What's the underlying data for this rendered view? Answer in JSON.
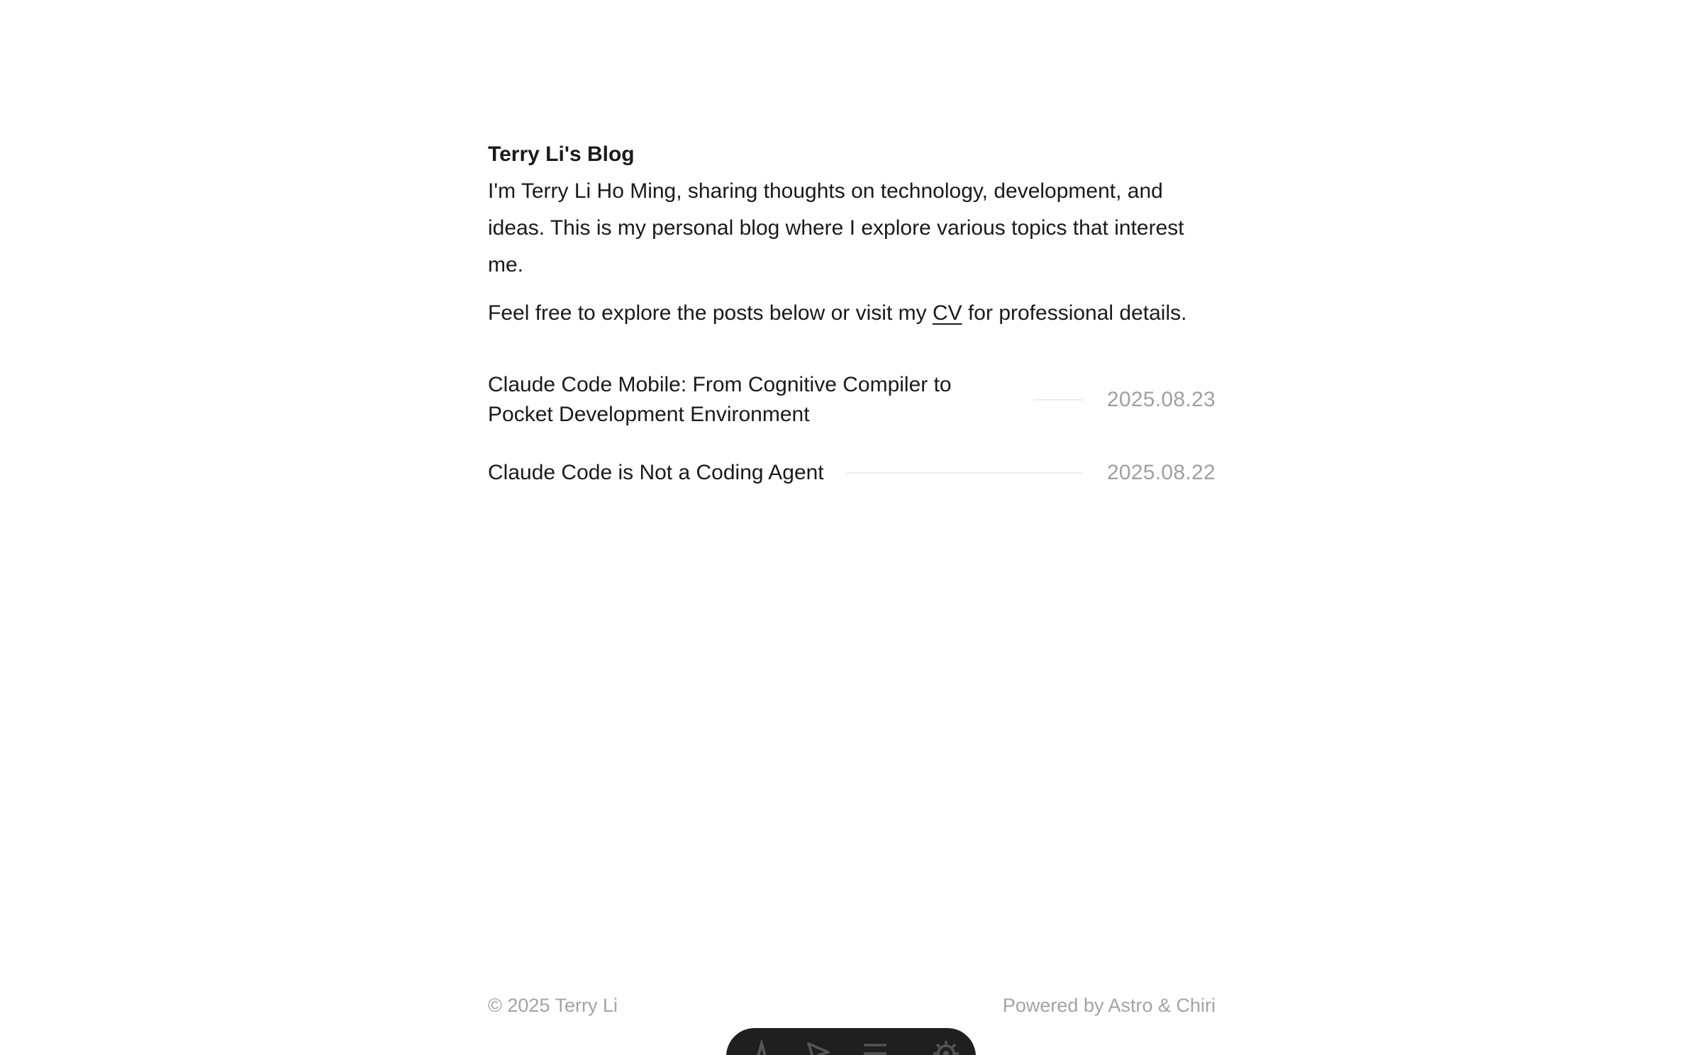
{
  "header": {
    "site_title": "Terry Li's Blog"
  },
  "intro": {
    "paragraph1": "I'm Terry Li Ho Ming, sharing thoughts on technology, development, and ideas. This is my personal blog where I explore various topics that interest me.",
    "paragraph2_before": "Feel free to explore the posts below or visit my ",
    "cv_link": "CV",
    "paragraph2_after": " for professional details."
  },
  "posts": [
    {
      "title": "Claude Code Mobile: From Cognitive Compiler to Pocket Development Environment",
      "date": "2025.08.23"
    },
    {
      "title": "Claude Code is Not a Coding Agent",
      "date": "2025.08.22"
    }
  ],
  "footer": {
    "copyright": "© 2025 Terry Li",
    "powered_by": "Powered by Astro & Chiri"
  },
  "toolbar": {
    "icons": [
      "astro-logo-icon",
      "audit-icon",
      "menu-icon",
      "settings-gear-icon"
    ]
  }
}
